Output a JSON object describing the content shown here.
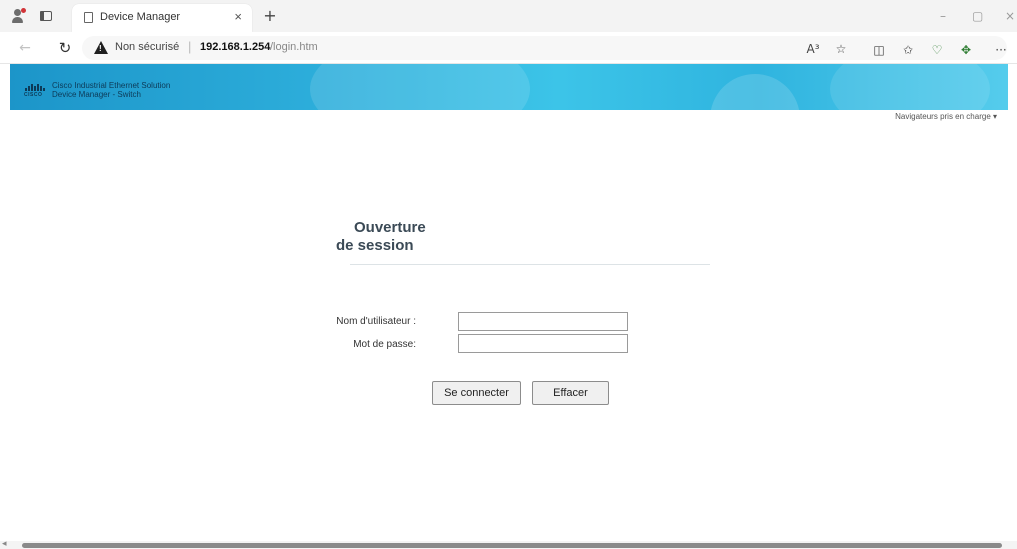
{
  "browser": {
    "tab_title": "Device Manager",
    "tab_close": "×",
    "new_tab": "+",
    "window_controls": {
      "minimize": "–",
      "maximize": "▢",
      "close": "×"
    },
    "address": {
      "security_label": "Non sécurisé",
      "separator": "|",
      "host": "192.168.1.254",
      "path": "/login.htm"
    },
    "toolbar_icons": [
      "read-aloud-icon",
      "favorite-star-icon",
      "split-screen-icon",
      "favorites-icon",
      "browser-essentials-icon",
      "extension-icon",
      "more-icon"
    ],
    "toolbar_glyphs": {
      "read_aloud": "A³",
      "favorite": "☆",
      "split": "◫",
      "favorites": "✩",
      "essentials": "♡",
      "extension": "✥",
      "more": "···"
    }
  },
  "banner": {
    "logo_word": "CISCO",
    "product_name": "Cisco Industrial Ethernet Solution",
    "product_sub": "Device Manager - Switch",
    "supported_browsers": "Navigateurs pris en charge ▾"
  },
  "login": {
    "title_line1": "Ouverture",
    "title_line2": "de session",
    "username_label": "Nom d'utilisateur :",
    "password_label": "Mot de passe:",
    "username_value": "",
    "password_value": "",
    "connect_button": "Se connecter",
    "clear_button": "Effacer"
  },
  "colors": {
    "banner_start": "#1c95c9",
    "banner_end": "#55ccec",
    "title_text": "#3b4a56"
  }
}
